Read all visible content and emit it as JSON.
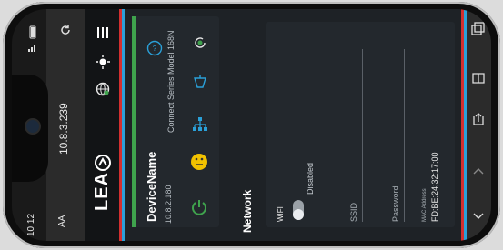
{
  "status_bar": {
    "time": "10:12",
    "font_size_control": "AA"
  },
  "browser": {
    "url": "10.8.3.239"
  },
  "app": {
    "logo_text": "LEA"
  },
  "device": {
    "name": "DeviceName",
    "ip": "10.8.2.180",
    "model": "Connect Series Model 168N"
  },
  "network": {
    "title": "Network",
    "wifi_label": "WIFI",
    "wifi_state": "Disabled",
    "ssid_placeholder": "SSID",
    "password_placeholder": "Password",
    "mac_label": "MAC Address",
    "mac_value": "FD:BE:24:32:17:00"
  },
  "colors": {
    "accent_red": "#d32f2f",
    "accent_blue": "#2aa0d8",
    "online_green": "#3fa34d",
    "status_yellow": "#f2c200"
  },
  "icons": {
    "reload": "reload-icon",
    "menu": "hamburger-menu-icon",
    "brightness": "brightness-icon",
    "globe": "globe-icon",
    "help": "help-icon",
    "refresh_device": "refresh-device-icon",
    "network_tree": "network-tree-icon",
    "amp": "amplifier-icon",
    "emoji": "status-face-icon",
    "power": "power-icon"
  }
}
